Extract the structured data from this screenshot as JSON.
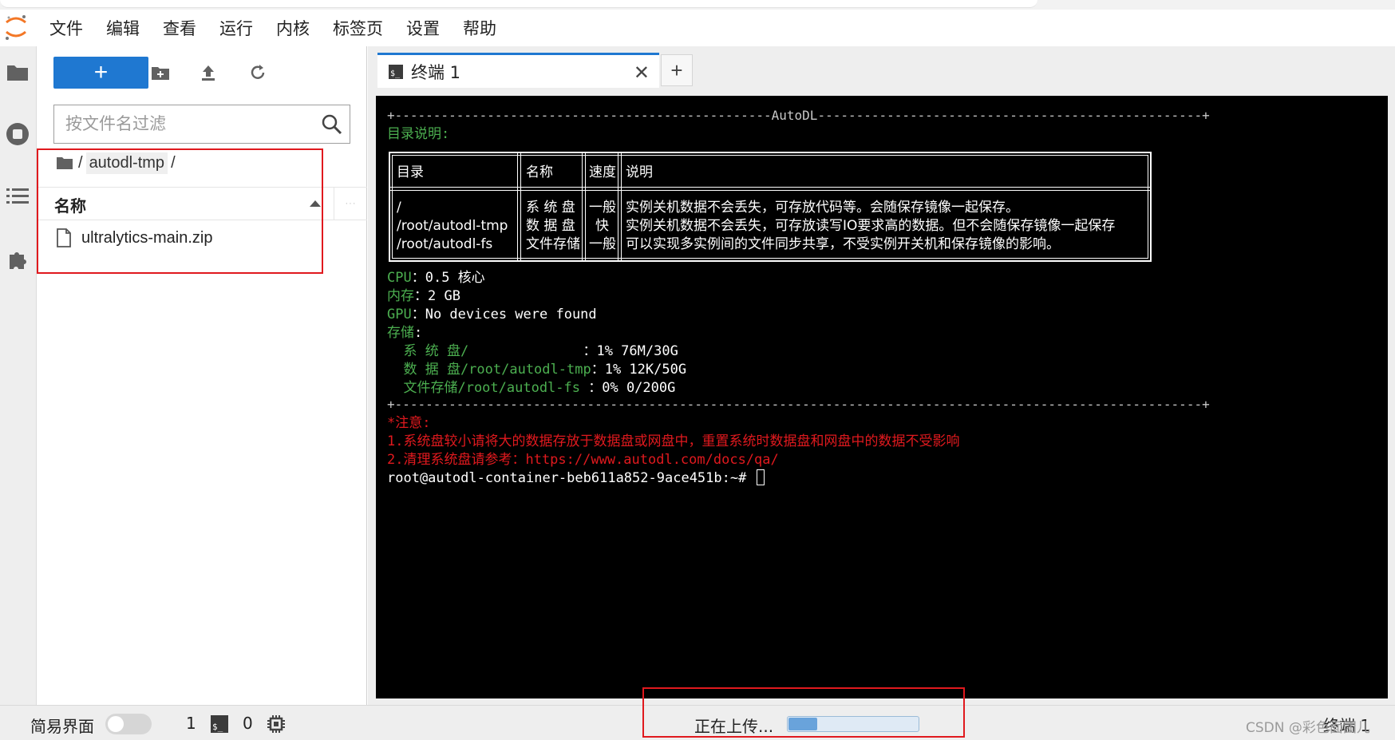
{
  "menu": [
    "文件",
    "编辑",
    "查看",
    "运行",
    "内核",
    "标签页",
    "设置",
    "帮助"
  ],
  "filebrowser": {
    "new_button_label": "+",
    "filter_placeholder": "按文件名过滤",
    "breadcrumb": {
      "sep1": "/",
      "folder": "autodl-tmp",
      "sep2": "/"
    },
    "column_name": "名称",
    "column_more": "···",
    "files": [
      {
        "name": "ultralytics-main.zip"
      }
    ]
  },
  "tabs": [
    {
      "icon_text": "$_",
      "label": "终端 1",
      "close": "✕"
    }
  ],
  "tab_add_label": "+",
  "terminal": {
    "banner_top": "+-------------------------------------------------AutoDL--------------------------------------------------+",
    "dir_title": "目录说明:",
    "table": {
      "headers": [
        "目录",
        "名称",
        "速度",
        "说明"
      ],
      "rows": [
        [
          "/",
          "系 统 盘",
          "一般",
          "实例关机数据不会丢失，可存放代码等。会随保存镜像一起保存。"
        ],
        [
          "/root/autodl-tmp",
          "数 据 盘",
          "快",
          "实例关机数据不会丢失，可存放读写IO要求高的数据。但不会随保存镜像一起保存"
        ],
        [
          "/root/autodl-fs",
          "文件存储",
          "一般",
          "可以实现多实例间的文件同步共享，不受实例开关机和保存镜像的影响。"
        ]
      ]
    },
    "cpu_label": "CPU",
    "cpu_value": "：0.5 核心",
    "mem_label": "内存",
    "mem_value": "：2 GB",
    "gpu_label": "GPU",
    "gpu_value": "：No devices were found",
    "storage_label": "存储",
    "storage_colon": ":",
    "storage": [
      {
        "label": "  系 统 盘/              ",
        "value": "：1% 76M/30G"
      },
      {
        "label": "  数 据 盘/root/autodl-tmp",
        "value": "：1% 12K/50G"
      },
      {
        "label": "  文件存储/root/autodl-fs ",
        "value": "：0% 0/200G"
      }
    ],
    "banner_bottom": "+---------------------------------------------------------------------------------------------------------+",
    "notice_title": "*注意:",
    "notice_1": "1.系统盘较小请将大的数据存放于数据盘或网盘中，重置系统时数据盘和网盘中的数据不受影响",
    "notice_2": "2.清理系统盘请参考：https://www.autodl.com/docs/qa/",
    "prompt": "root@autodl-container-beb611a852-9ace451b:~# "
  },
  "statusbar": {
    "simple_mode_label": "简易界面",
    "simple_mode_on": false,
    "terminals_count": "1",
    "terminal_icon_text": "$_",
    "kernels_count": "0",
    "upload_text": "正在上传...",
    "upload_progress": 0.22,
    "right_text": "终端 1",
    "watermark": "CSDN @彩色面团儿"
  },
  "colors": {
    "accent": "#1f78d1",
    "terminal_green": "#4caf50",
    "terminal_red": "#e0191e",
    "highlight_red": "#e0191e"
  }
}
